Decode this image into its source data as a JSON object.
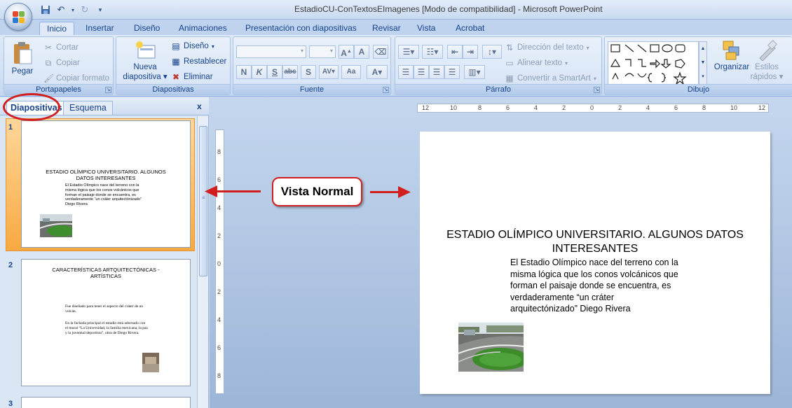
{
  "window": {
    "title": "EstadioCU-ConTextosEImagenes [Modo de compatibilidad] - Microsoft PowerPoint"
  },
  "tabs": [
    "Inicio",
    "Insertar",
    "Diseño",
    "Animaciones",
    "Presentación con diapositivas",
    "Revisar",
    "Vista",
    "Acrobat"
  ],
  "active_tab": "Inicio",
  "ribbon": {
    "portapapeles": {
      "label": "Portapapeles",
      "pegar": "Pegar",
      "cortar": "Cortar",
      "copiar": "Copiar",
      "copiar_formato": "Copiar formato"
    },
    "diapositivas": {
      "label": "Diapositivas",
      "nueva": "Nueva",
      "diapositiva": "diapositiva",
      "diseno": "Diseño",
      "restablecer": "Restablecer",
      "eliminar": "Eliminar"
    },
    "fuente": {
      "label": "Fuente",
      "bold": "N",
      "italic": "K",
      "underline": "S",
      "strike": "abc",
      "case": "Aa"
    },
    "parrafo": {
      "label": "Párrafo",
      "direccion": "Dirección del texto",
      "alinear": "Alinear texto",
      "smartart": "Convertir a SmartArt"
    },
    "dibujo": {
      "label": "Dibujo",
      "organizar": "Organizar",
      "estilos1": "Estilos",
      "estilos2": "rápidos"
    }
  },
  "pane": {
    "tab_slides": "Diapositivas",
    "tab_outline": "Esquema",
    "close": "x"
  },
  "thumbs": [
    {
      "num": "1",
      "title": "ESTADIO OLÍMPICO UNIVERSITARIO.  ALGUNOS DATOS INTERESANTES",
      "body": "El Estadio Olímpico nace del terreno con la misma lógica que los conos volcánicos que forman el paisaje donde se encuentra,  es verdaderamente “un cráter arquitectónizado”   Diego Rivera"
    },
    {
      "num": "2",
      "title": "CARACTERÍSTICAS ARTQUITECTÓNICAS - ARTÍSTICAS",
      "body1": "Fue diseñado para tener el aspecto del cráter de un volcán.",
      "body2": "En la fachada principal el estadio está adornado con el mural “La Universidad, la familia mexicana, la paz y la juventud deportista”, obra de Diego Rivera."
    },
    {
      "num": "3"
    }
  ],
  "slide": {
    "title": "ESTADIO OLÍMPICO UNIVERSITARIO.  ALGUNOS DATOS INTERESANTES",
    "body": [
      "El Estadio Olímpico nace del terreno con la",
      "misma lógica que los conos volcánicos que",
      "forman el paisaje donde se encuentra,  es",
      "verdaderamente “un cráter",
      "arquitectónizado”   Diego Rivera"
    ]
  },
  "rulers": {
    "h": [
      "12",
      "10",
      "8",
      "6",
      "4",
      "2",
      "0",
      "2",
      "4",
      "6",
      "8",
      "10",
      "12"
    ],
    "v": [
      "8",
      "6",
      "4",
      "2",
      "0",
      "2",
      "4",
      "6",
      "8"
    ]
  },
  "annotation": {
    "text": "Vista Normal"
  },
  "colors": {
    "accent": "#d11f1f",
    "ribbon": "#dfe9f7",
    "selected_thumb": "#f7a941"
  }
}
